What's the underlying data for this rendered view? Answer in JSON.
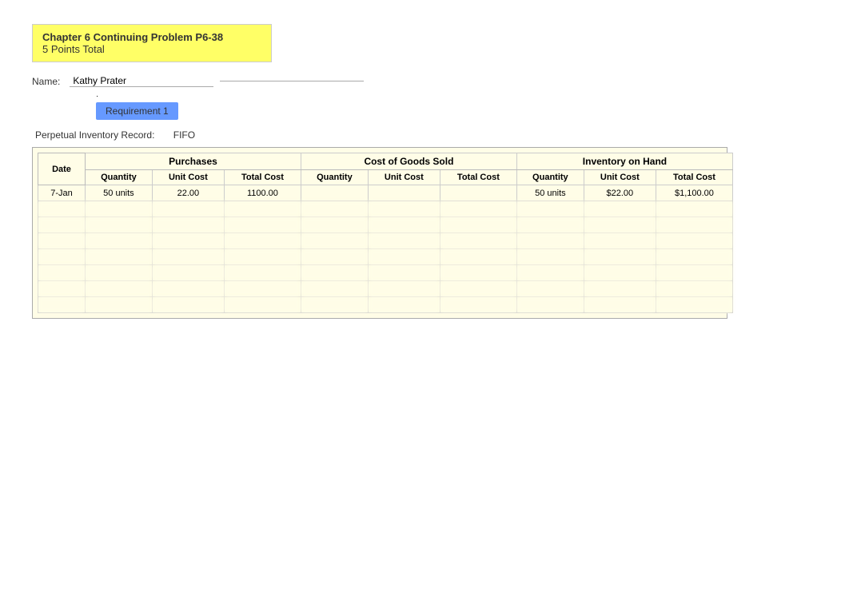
{
  "header": {
    "title": "Chapter 6 Continuing Problem P6-38",
    "points": "5 Points Total",
    "name_label": "Name:",
    "name_value": "Kathy Prater",
    "requirement_btn": "Requirement 1"
  },
  "record": {
    "label": "Perpetual Inventory Record:",
    "method": "FIFO"
  },
  "table": {
    "sections": {
      "purchases": "Purchases",
      "cogs": "Cost of Goods Sold",
      "inventory": "Inventory on Hand"
    },
    "sub_headers": {
      "date": "Date",
      "purchases": [
        "Quantity",
        "Unit Cost",
        "Total Cost"
      ],
      "cogs": [
        "Quantity",
        "Unit Cost",
        "Total Cost"
      ],
      "inventory": [
        "Quantity",
        "Total Cost"
      ]
    },
    "rows": [
      {
        "date": "7-Jan",
        "p_qty": "50 units",
        "p_unit": "22.00",
        "p_total": "1100.00",
        "c_qty": "",
        "c_unit": "",
        "c_total": "",
        "i_qty": "50 units",
        "i_unit": "$22.00",
        "i_total": "$1,100.00",
        "i_total2": "$1,100"
      },
      {
        "date": "",
        "p_qty": "",
        "p_unit": "",
        "p_total": "",
        "c_qty": "",
        "c_unit": "",
        "c_total": "",
        "i_qty": "",
        "i_unit": "",
        "i_total": "",
        "i_total2": ""
      },
      {
        "date": "",
        "p_qty": "",
        "p_unit": "",
        "p_total": "",
        "c_qty": "",
        "c_unit": "",
        "c_total": "",
        "i_qty": "",
        "i_unit": "",
        "i_total": "",
        "i_total2": ""
      },
      {
        "date": "",
        "p_qty": "",
        "p_unit": "",
        "p_total": "",
        "c_qty": "",
        "c_unit": "",
        "c_total": "",
        "i_qty": "",
        "i_unit": "",
        "i_total": "",
        "i_total2": ""
      },
      {
        "date": "",
        "p_qty": "",
        "p_unit": "",
        "p_total": "",
        "c_qty": "",
        "c_unit": "",
        "c_total": "",
        "i_qty": "",
        "i_unit": "",
        "i_total": "",
        "i_total2": ""
      },
      {
        "date": "",
        "p_qty": "",
        "p_unit": "",
        "p_total": "",
        "c_qty": "",
        "c_unit": "",
        "c_total": "",
        "i_qty": "",
        "i_unit": "",
        "i_total": "",
        "i_total2": ""
      },
      {
        "date": "",
        "p_qty": "",
        "p_unit": "",
        "p_total": "",
        "c_qty": "",
        "c_unit": "",
        "c_total": "",
        "i_qty": "",
        "i_unit": "",
        "i_total": "",
        "i_total2": ""
      },
      {
        "date": "",
        "p_qty": "",
        "p_unit": "",
        "p_total": "",
        "c_qty": "",
        "c_unit": "",
        "c_total": "",
        "i_qty": "",
        "i_unit": "",
        "i_total": "",
        "i_total2": ""
      }
    ]
  }
}
